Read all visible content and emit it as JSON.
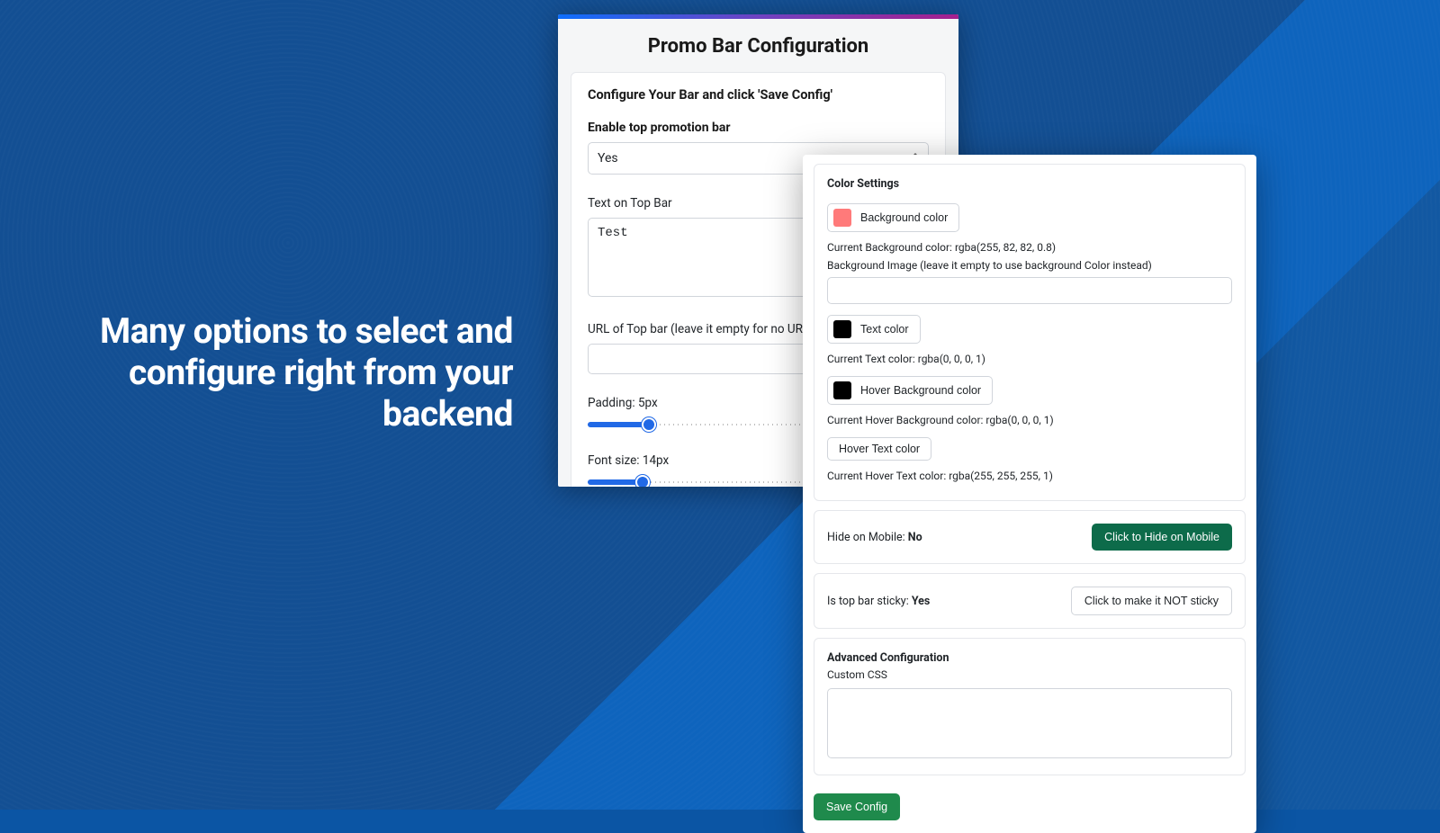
{
  "hero": {
    "text": "Many options to select and configure right from your backend"
  },
  "config": {
    "page_title": "Promo Bar Configuration",
    "section_msg": "Configure Your Bar and click 'Save Config'",
    "enable_label": "Enable top promotion bar",
    "enable_value": "Yes",
    "text_label": "Text on Top Bar",
    "text_value": "Test",
    "url_label": "URL of Top bar (leave it empty for no URL)",
    "url_value": "",
    "padding_label": "Padding: 5px",
    "fontsize_label": "Font size: 14px"
  },
  "colors": {
    "section_title": "Color Settings",
    "bg_btn_label": "Background color",
    "bg_current": "Current Background color: rgba(255, 82, 82, 0.8)",
    "bg_image_label": "Background Image (leave it empty to use background Color instead)",
    "bg_image_value": "",
    "text_btn_label": "Text color",
    "text_current": "Current Text color: rgba(0, 0, 0, 1)",
    "hoverbg_btn_label": "Hover Background color",
    "hoverbg_current": "Current Hover Background color: rgba(0, 0, 0, 1)",
    "hovertext_btn_label": "Hover Text color",
    "hovertext_current": "Current Hover Text color: rgba(255, 255, 255, 1)"
  },
  "mobile": {
    "label_prefix": "Hide on Mobile: ",
    "label_value": "No",
    "button": "Click to Hide on Mobile"
  },
  "sticky": {
    "label_prefix": "Is top bar sticky: ",
    "label_value": "Yes",
    "button": "Click to make it NOT sticky"
  },
  "advanced": {
    "title": "Advanced Configuration",
    "custom_css_label": "Custom CSS",
    "custom_css_value": ""
  },
  "save_label": "Save Config"
}
